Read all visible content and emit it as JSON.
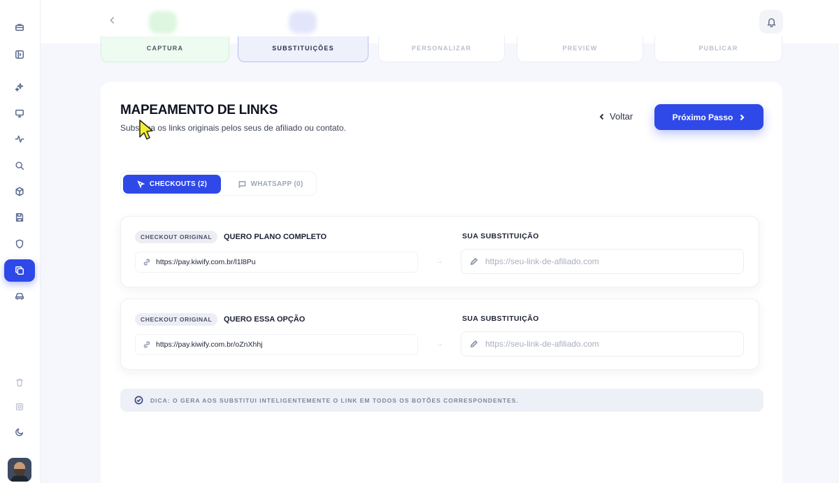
{
  "topbar": {
    "back_icon": "chevron-left-icon",
    "notifications_icon": "bell-icon"
  },
  "sidebar": {
    "icons": [
      "toolbox-icon",
      "panel-collapse-icon",
      "sparkles-icon",
      "monitor-icon",
      "activity-icon",
      "search-icon",
      "cube-icon",
      "save-icon",
      "shield-icon",
      "copy-icon",
      "car-icon",
      "trash-icon",
      "square-icon",
      "moon-icon"
    ],
    "active_icon": "copy-icon"
  },
  "steps": [
    {
      "label": "CAPTURA",
      "state": "done"
    },
    {
      "label": "SUBSTITUIÇÕES",
      "state": "current"
    },
    {
      "label": "PERSONALIZAR",
      "state": "pending"
    },
    {
      "label": "PREVIEW",
      "state": "pending"
    },
    {
      "label": "PUBLICAR",
      "state": "pending"
    }
  ],
  "main": {
    "title": "MAPEAMENTO DE LINKS",
    "subtitle": "Substitua os links originais pelos seus de afiliado ou contato.",
    "back_label": "Voltar",
    "next_label": "Próximo Passo"
  },
  "tabs": [
    {
      "label": "CHECKOUTS (2)",
      "icon": "cursor-click-icon",
      "active": true
    },
    {
      "label": "WHATSAPP (0)",
      "icon": "message-icon",
      "active": false
    }
  ],
  "checkouts": [
    {
      "badge": "CHECKOUT ORIGINAL",
      "label": "QUERO PLANO COMPLETO",
      "original_url": "https://pay.kiwify.com.br/l1l8Pu",
      "substitution_label": "SUA SUBSTITUIÇÃO",
      "substitution_value": "",
      "substitution_placeholder": "https://seu-link-de-afiliado.com"
    },
    {
      "badge": "CHECKOUT ORIGINAL",
      "label": "QUERO ESSA OPÇÃO",
      "original_url": "https://pay.kiwify.com.br/oZnXhhj",
      "substitution_label": "SUA SUBSTITUIÇÃO",
      "substitution_value": "",
      "substitution_placeholder": "https://seu-link-de-afiliado.com"
    }
  ],
  "tip": {
    "text": "DICA: O GERA AOS SUBSTITUI INTELIGENTEMENTE O LINK EM TODOS OS BOTÕES CORRESPONDENTES."
  },
  "colors": {
    "accent": "#2f49e8",
    "done_step_bg": "#eefbf0",
    "current_step_bg": "#eef0fc"
  }
}
